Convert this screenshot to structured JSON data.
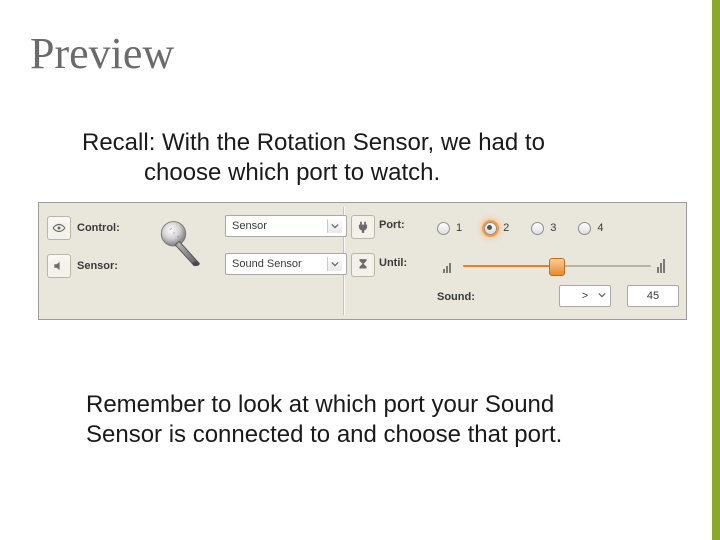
{
  "title": "Preview",
  "lead_line1": "Recall: With the Rotation Sensor, we had to",
  "lead_line2": "choose which port to watch.",
  "panel": {
    "control_label": "Control:",
    "sensor_label": "Sensor:",
    "control_value": "Sensor",
    "sensor_type_value": "Sound Sensor",
    "port_label": "Port:",
    "until_label": "Until:",
    "sound_label": "Sound:",
    "ports": [
      "1",
      "2",
      "3",
      "4"
    ],
    "port_selected_index": 1,
    "compare_op": ">",
    "threshold": "45",
    "slider_percent": 45
  },
  "foot_line1": "Remember to look at which port your Sound",
  "foot_line2": "Sensor is connected to and choose that port.",
  "icons": {
    "eye": "eye-icon",
    "speaker": "speaker-icon",
    "plug": "plug-icon",
    "hourglass": "hourglass-icon",
    "microphone": "microphone-icon"
  }
}
